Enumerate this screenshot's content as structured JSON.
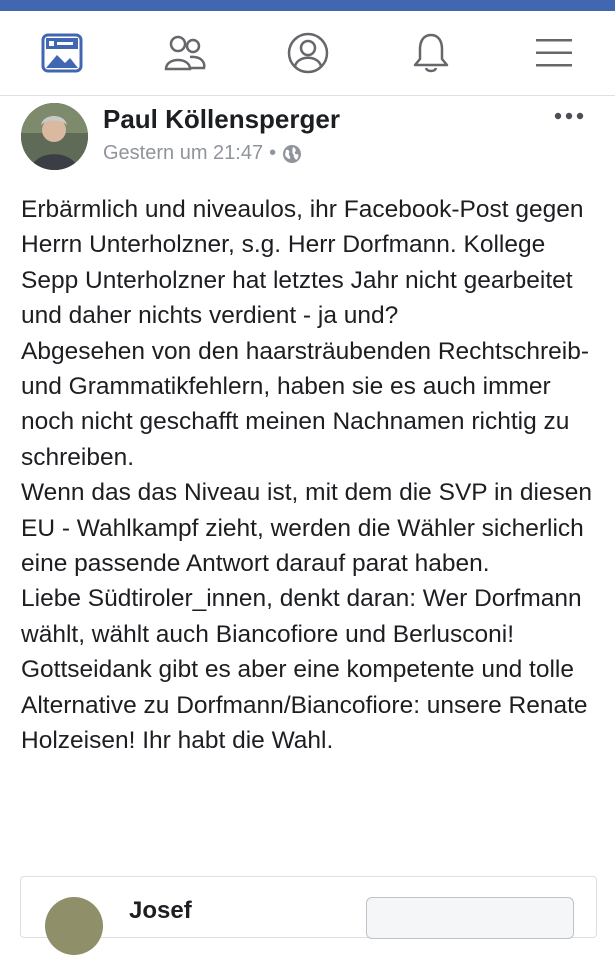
{
  "colors": {
    "brand": "#4267b2",
    "text": "#1c1e21",
    "meta": "#90949c",
    "icon": "#65676b"
  },
  "nav": {
    "items": [
      "news-feed-icon",
      "friends-icon",
      "profile-icon",
      "notifications-icon",
      "menu-icon"
    ]
  },
  "post": {
    "author": "Paul Köllensperger",
    "time": "Gestern um 21:47",
    "separator": "•",
    "paragraphs": [
      "Erbärmlich und niveaulos, ihr Facebook-Post gegen Herrn Unterholzner, s.g. Herr Dorfmann. Kollege Sepp Unterholzner hat letztes Jahr nicht gearbeitet und daher nichts verdient - ja und?",
      "Abgesehen von den haarsträubenden Rechtschreib- und Grammatikfehlern, haben sie es auch immer noch nicht geschafft meinen Nachnamen richtig zu schreiben.",
      "Wenn das das Niveau ist, mit dem die SVP in diesen EU - Wahlkampf zieht, werden die Wähler sicherlich eine passende Antwort darauf parat haben.",
      "Liebe Südtiroler_innen, denkt daran: Wer Dorfmann wählt, wählt auch Biancofiore und Berlusconi!",
      "Gottseidank gibt es aber eine kompetente und tolle Alternative zu Dorfmann/Biancofiore: unsere Renate Holzeisen! Ihr habt die Wahl."
    ]
  },
  "comment": {
    "name": "Josef"
  }
}
